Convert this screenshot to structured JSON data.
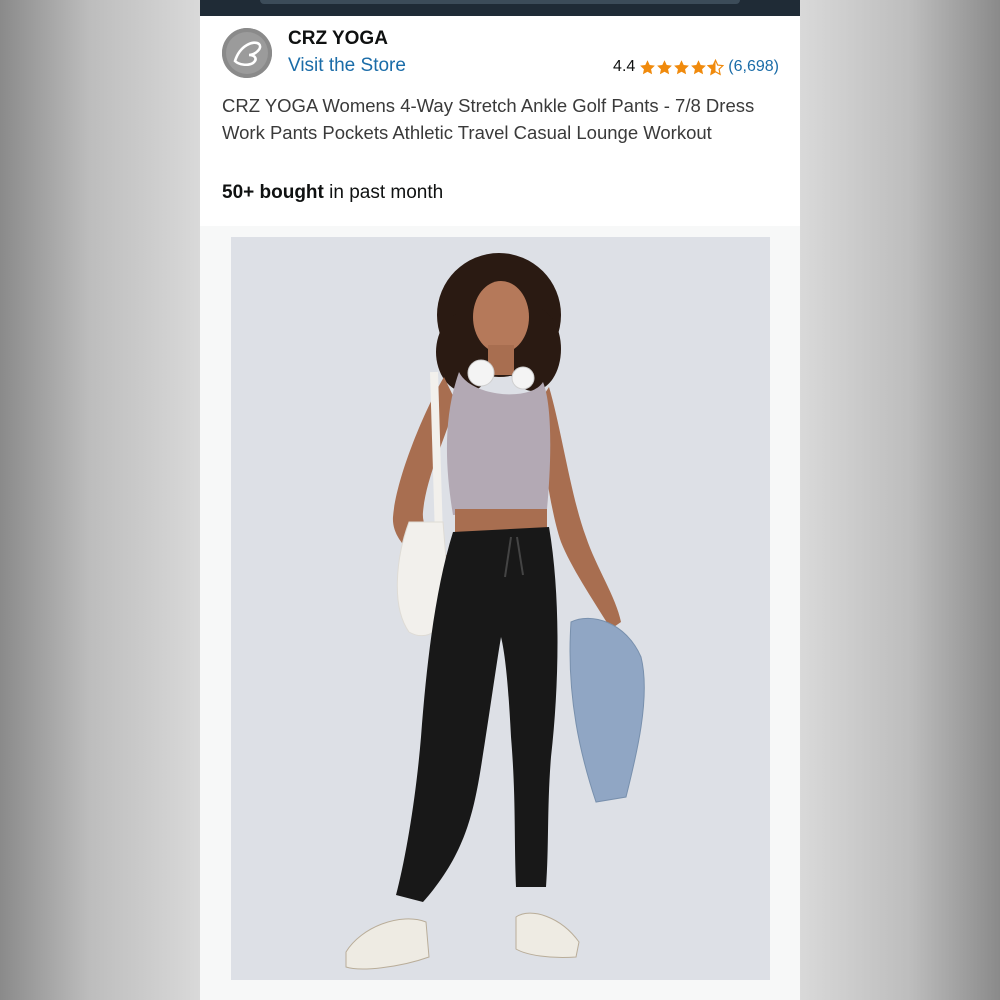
{
  "brand": {
    "name": "CRZ YOGA",
    "store_link": "Visit the Store"
  },
  "rating": {
    "value": "4.4",
    "stars": 4.4,
    "count": "(6,698)"
  },
  "product": {
    "title": "CRZ YOGA Womens 4-Way Stretch Ankle Golf Pants - 7/8 Dress Work Pants Pockets Athletic Travel Casual Lounge Workout",
    "bought_bold": "50+ bought",
    "bought_rest": " in past month"
  },
  "colors": {
    "link": "#1a6ca8",
    "star": "#f08a0c",
    "topbar": "#1f2b36"
  },
  "icons": {
    "logo": "crz-yoga-logo-icon",
    "star": "star-icon"
  }
}
